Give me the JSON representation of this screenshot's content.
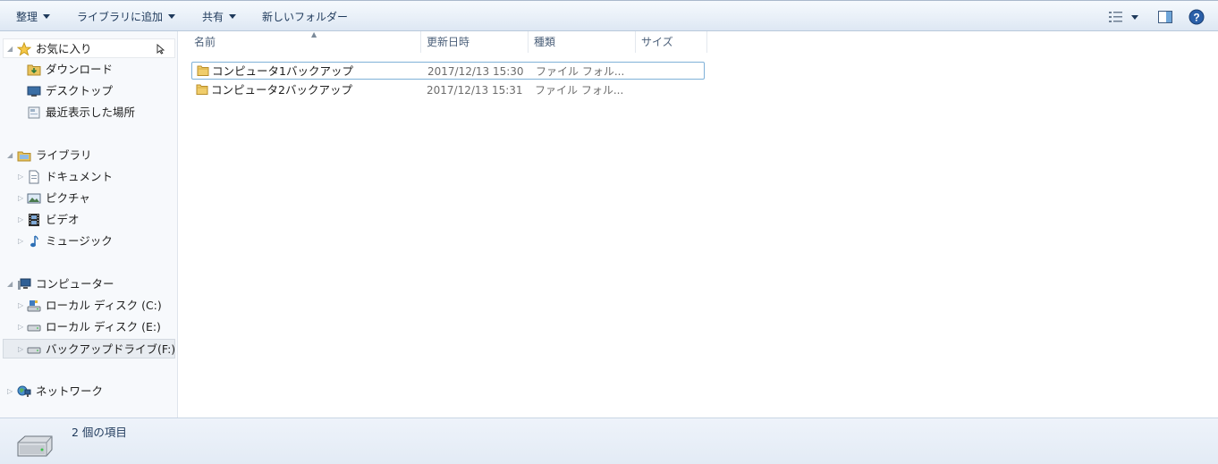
{
  "toolbar": {
    "organize": "整理",
    "add_to_library": "ライブラリに追加",
    "share": "共有",
    "new_folder": "新しいフォルダー"
  },
  "nav": {
    "favorites": "お気に入り",
    "downloads": "ダウンロード",
    "desktop": "デスクトップ",
    "recent": "最近表示した場所",
    "libraries": "ライブラリ",
    "documents": "ドキュメント",
    "pictures": "ピクチャ",
    "videos": "ビデオ",
    "music": "ミュージック",
    "computer": "コンピューター",
    "local_c": "ローカル ディスク (C:)",
    "local_e": "ローカル ディスク (E:)",
    "backup_f": "バックアップドライブ(F:)",
    "network": "ネットワーク"
  },
  "columns": {
    "name": "名前",
    "date": "更新日時",
    "type": "種類",
    "size": "サイズ"
  },
  "files": [
    {
      "name": "コンピュータ1バックアップ",
      "date": "2017/12/13 15:30",
      "type": "ファイル フォル..."
    },
    {
      "name": "コンピュータ2バックアップ",
      "date": "2017/12/13 15:31",
      "type": "ファイル フォル..."
    }
  ],
  "details": {
    "count": "2 個の項目"
  }
}
